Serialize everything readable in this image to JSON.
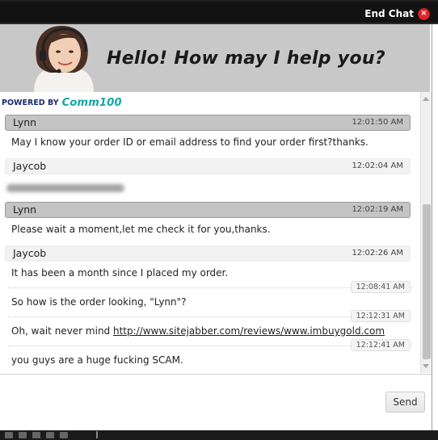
{
  "header": {
    "end_chat_label": "End Chat",
    "close_glyph": "×"
  },
  "banner": {
    "greeting": "Hello! How may I help you?",
    "agent_image": "headset-agent-photo"
  },
  "powered": {
    "prefix": "POWERED BY",
    "brand": "Comm100",
    "brand_color": "#11a6a6"
  },
  "messages": [
    {
      "sender": "Lynn",
      "role": "agent",
      "time": "12:01:50 AM",
      "lines": [
        {
          "text": "May I know your order ID or email address to find your order first?thanks."
        }
      ]
    },
    {
      "sender": "Jaycob",
      "role": "visitor",
      "time": "12:02:04 AM",
      "lines": [
        {
          "redacted": true
        }
      ]
    },
    {
      "sender": "Lynn",
      "role": "agent",
      "time": "12:02:19 AM",
      "lines": [
        {
          "text": "Please wait a moment,let me check it for you,thanks."
        }
      ]
    },
    {
      "sender": "Jaycob",
      "role": "visitor",
      "time": "12:02:26 AM",
      "lines": [
        {
          "text": "It has been a month since I placed my order."
        },
        {
          "time": "12:08:41 AM",
          "text": "So how is the order looking, \"Lynn\"?"
        },
        {
          "time": "12:12:31 AM",
          "text_prefix": "Oh, wait never mind ",
          "link": "http://www.sitejabber.com/reviews/www.imbuygold.com"
        },
        {
          "time": "12:12:41 AM",
          "text": "you guys are a huge fucking SCAM."
        }
      ]
    }
  ],
  "composer": {
    "send_label": "Send",
    "input_value": ""
  },
  "colors": {
    "agent_header_bg": "#c4c4c4",
    "visitor_header_bg": "#f2f2f2",
    "banner_bg": "#c8c8c8",
    "topbar_bg": "#121212",
    "close_red": "#e0252a"
  }
}
